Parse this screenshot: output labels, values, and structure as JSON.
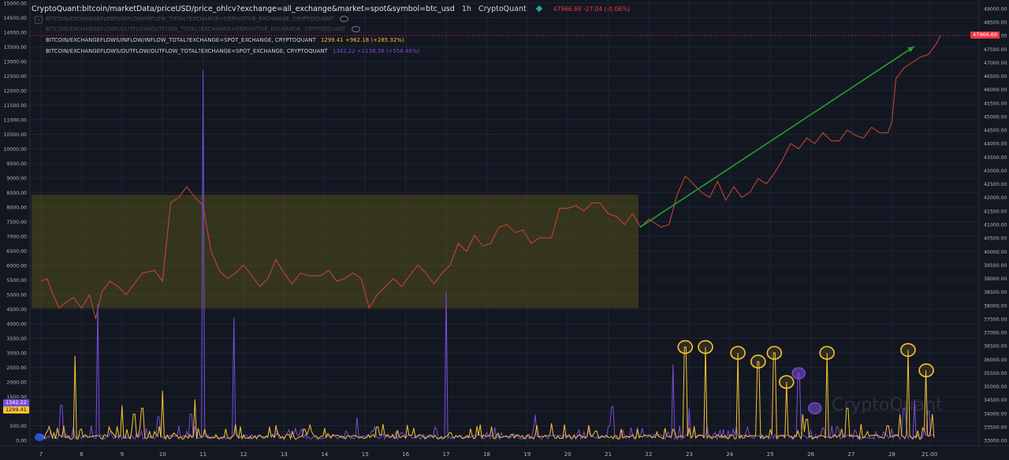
{
  "header": {
    "symbol": "CryptoQuant:bitcoin/marketData/priceUSD/price_ohlcv?exchange=all_exchange&market=spot&symbol=btc_usd",
    "interval": "1h",
    "source": "CryptoQuant",
    "ohlc": "47966.69  -27.04 (-0.06%)"
  },
  "legend": [
    {
      "label": "BITCOIN/EXCHANGEFLOWS/INFLOW/INFLOW_TOTAL?EXCHANGE=DERIVATIVE_EXCHANGE, CRYPTOQUANT",
      "value": "",
      "color": "#4a4d58",
      "hidden": true
    },
    {
      "label": "BITCOIN/EXCHANGEFLOWS/OUTFLOW/OUTFLOW_TOTAL?EXCHANGE=DERIVATIVE_EXCHANGE, CRYPTOQUANT",
      "value": "",
      "color": "#4a4d58",
      "hidden": true
    },
    {
      "label": "BITCOIN/EXCHANGEFLOWS/INFLOW/INFLOW_TOTAL?EXCHANGE=SPOT_EXCHANGE, CRYPTOQUANT",
      "value": "1299.41  +962.18 (+285.32%)",
      "color": "#f7c330",
      "hidden": false
    },
    {
      "label": "BITCOIN/EXCHANGEFLOWS/OUTFLOW/OUTFLOW_TOTAL?EXCHANGE=SPOT_EXCHANGE, CRYPTOQUANT",
      "value": "1342.22  +1138.38 (+558.46%)",
      "color": "#7b4dd8",
      "hidden": false
    }
  ],
  "price_tag": "47966.69",
  "left_tags": {
    "outflow": "1342.22",
    "inflow": "1299.41"
  },
  "watermark": "CryptoQuant",
  "colors": {
    "background": "#131722",
    "price": "#c0452e",
    "inflow": "#f7c330",
    "outflow": "#7b4dd8",
    "trend_arrow": "#22a02a",
    "range_box": "#6e6414"
  },
  "chart_data": {
    "type": "line",
    "x_tick_labels": [
      "7",
      "8",
      "9",
      "10",
      "11",
      "12",
      "13",
      "14",
      "15",
      "16",
      "17",
      "18",
      "19",
      "20",
      "21",
      "22",
      "23",
      "24",
      "25",
      "26",
      "27",
      "28",
      "21:00"
    ],
    "left_axis": {
      "ylim": [
        0,
        15000
      ],
      "ticks": [
        0,
        500,
        1000,
        1500,
        2000,
        2500,
        3000,
        3500,
        4000,
        4500,
        5000,
        5500,
        6000,
        6500,
        7000,
        7500,
        8000,
        8500,
        9000,
        9500,
        10000,
        10500,
        11000,
        11500,
        12000,
        12500,
        13000,
        13500,
        14000,
        14500,
        15000
      ]
    },
    "right_axis": {
      "ylim": [
        32800,
        49200
      ],
      "ticks": [
        33000,
        33500,
        34000,
        34500,
        35000,
        35500,
        36000,
        36500,
        37000,
        37500,
        38000,
        38500,
        39000,
        39500,
        40000,
        40500,
        41000,
        41500,
        42000,
        42500,
        43000,
        43500,
        44000,
        44500,
        45000,
        45500,
        46000,
        46500,
        47000,
        47500,
        48000,
        48500,
        49000
      ]
    },
    "series": [
      {
        "name": "price_usd",
        "axis": "right",
        "points": [
          [
            0,
            38900
          ],
          [
            0.15,
            39000
          ],
          [
            0.3,
            38400
          ],
          [
            0.45,
            37900
          ],
          [
            0.6,
            38100
          ],
          [
            0.8,
            38300
          ],
          [
            1.0,
            37900
          ],
          [
            1.2,
            38400
          ],
          [
            1.35,
            37500
          ],
          [
            1.5,
            38500
          ],
          [
            1.7,
            38900
          ],
          [
            1.9,
            38700
          ],
          [
            2.1,
            38400
          ],
          [
            2.3,
            38800
          ],
          [
            2.5,
            39200
          ],
          [
            2.8,
            39300
          ],
          [
            3.0,
            38900
          ],
          [
            3.2,
            41800
          ],
          [
            3.4,
            42000
          ],
          [
            3.6,
            42400
          ],
          [
            3.8,
            42000
          ],
          [
            4.0,
            41700
          ],
          [
            4.2,
            40000
          ],
          [
            4.4,
            39300
          ],
          [
            4.6,
            39000
          ],
          [
            4.8,
            39200
          ],
          [
            5.0,
            39500
          ],
          [
            5.2,
            39100
          ],
          [
            5.4,
            38700
          ],
          [
            5.6,
            39000
          ],
          [
            5.8,
            39700
          ],
          [
            6.0,
            39200
          ],
          [
            6.2,
            38800
          ],
          [
            6.4,
            39200
          ],
          [
            6.6,
            39100
          ],
          [
            6.9,
            39100
          ],
          [
            7.1,
            39300
          ],
          [
            7.3,
            38900
          ],
          [
            7.5,
            39000
          ],
          [
            7.7,
            39200
          ],
          [
            7.9,
            39000
          ],
          [
            8.1,
            37900
          ],
          [
            8.3,
            38400
          ],
          [
            8.5,
            38700
          ],
          [
            8.7,
            39000
          ],
          [
            8.9,
            38700
          ],
          [
            9.1,
            39100
          ],
          [
            9.3,
            39500
          ],
          [
            9.5,
            39200
          ],
          [
            9.7,
            38800
          ],
          [
            9.9,
            39200
          ],
          [
            10.1,
            39500
          ],
          [
            10.3,
            40300
          ],
          [
            10.5,
            40000
          ],
          [
            10.7,
            40600
          ],
          [
            10.9,
            40200
          ],
          [
            11.1,
            40300
          ],
          [
            11.3,
            40900
          ],
          [
            11.5,
            41000
          ],
          [
            11.7,
            40700
          ],
          [
            11.9,
            40800
          ],
          [
            12.1,
            40300
          ],
          [
            12.3,
            40500
          ],
          [
            12.6,
            40500
          ],
          [
            12.8,
            41600
          ],
          [
            13.0,
            41600
          ],
          [
            13.2,
            41700
          ],
          [
            13.4,
            41500
          ],
          [
            13.6,
            41800
          ],
          [
            13.8,
            41800
          ],
          [
            14.0,
            41400
          ],
          [
            14.2,
            41300
          ],
          [
            14.4,
            41000
          ],
          [
            14.6,
            41400
          ],
          [
            14.8,
            40900
          ],
          [
            15.0,
            41200
          ],
          [
            15.3,
            40900
          ],
          [
            15.5,
            41000
          ],
          [
            15.7,
            42100
          ],
          [
            15.9,
            42800
          ],
          [
            16.1,
            42500
          ],
          [
            16.3,
            42200
          ],
          [
            16.5,
            42000
          ],
          [
            16.7,
            42600
          ],
          [
            16.9,
            41900
          ],
          [
            17.1,
            42400
          ],
          [
            17.3,
            42000
          ],
          [
            17.5,
            42200
          ],
          [
            17.7,
            42700
          ],
          [
            17.9,
            42500
          ],
          [
            18.1,
            42900
          ],
          [
            18.3,
            43400
          ],
          [
            18.5,
            44000
          ],
          [
            18.7,
            43800
          ],
          [
            18.9,
            44200
          ],
          [
            19.1,
            44000
          ],
          [
            19.3,
            44400
          ],
          [
            19.5,
            44100
          ],
          [
            19.7,
            44100
          ],
          [
            19.9,
            44500
          ],
          [
            20.1,
            44300
          ],
          [
            20.3,
            44200
          ],
          [
            20.5,
            44600
          ],
          [
            20.7,
            44400
          ],
          [
            20.9,
            44400
          ],
          [
            21.0,
            44800
          ],
          [
            21.1,
            46400
          ],
          [
            21.3,
            46800
          ],
          [
            21.5,
            47000
          ],
          [
            21.7,
            47200
          ],
          [
            21.9,
            47300
          ],
          [
            22.1,
            47700
          ],
          [
            22.2,
            48000
          ]
        ]
      },
      {
        "name": "inflow_spot",
        "axis": "left",
        "spikes": [
          [
            0.15,
            300
          ],
          [
            0.55,
            500
          ],
          [
            0.85,
            2900
          ],
          [
            1.35,
            150
          ],
          [
            2.0,
            1200
          ],
          [
            2.3,
            900
          ],
          [
            2.5,
            1100
          ],
          [
            2.8,
            300
          ],
          [
            3.0,
            1700
          ],
          [
            3.8,
            1400
          ],
          [
            4.05,
            380
          ],
          [
            4.5,
            100
          ],
          [
            5.6,
            100
          ],
          [
            5.8,
            520
          ],
          [
            6.2,
            320
          ],
          [
            6.5,
            380
          ],
          [
            7.4,
            100
          ],
          [
            7.9,
            120
          ],
          [
            8.3,
            460
          ],
          [
            8.8,
            350
          ],
          [
            9.2,
            420
          ],
          [
            10.1,
            260
          ],
          [
            10.6,
            400
          ],
          [
            11.4,
            120
          ],
          [
            11.8,
            160
          ],
          [
            12.2,
            200
          ],
          [
            12.6,
            580
          ],
          [
            13.3,
            180
          ],
          [
            13.7,
            320
          ],
          [
            14.2,
            160
          ],
          [
            14.6,
            200
          ],
          [
            15.0,
            180
          ],
          [
            15.4,
            420
          ],
          [
            15.6,
            380
          ],
          [
            15.9,
            3200
          ],
          [
            16.4,
            3200
          ],
          [
            17.2,
            3000
          ],
          [
            17.7,
            2700
          ],
          [
            18.1,
            3000
          ],
          [
            18.4,
            2000
          ],
          [
            18.8,
            900
          ],
          [
            18.9,
            720
          ],
          [
            19.4,
            3000
          ],
          [
            19.9,
            1100
          ],
          [
            20.4,
            300
          ],
          [
            20.9,
            500
          ],
          [
            21.2,
            900
          ],
          [
            21.4,
            3100
          ],
          [
            21.85,
            2400
          ],
          [
            22.0,
            900
          ]
        ]
      },
      {
        "name": "outflow_spot",
        "axis": "left",
        "spikes": [
          [
            0.5,
            1200
          ],
          [
            1.25,
            500
          ],
          [
            1.4,
            4700
          ],
          [
            2.9,
            800
          ],
          [
            3.7,
            900
          ],
          [
            4.0,
            12700
          ],
          [
            4.75,
            4200
          ],
          [
            5.4,
            180
          ],
          [
            6.6,
            120
          ],
          [
            7.8,
            780
          ],
          [
            8.9,
            250
          ],
          [
            10.0,
            5100
          ],
          [
            11.2,
            450
          ],
          [
            12.2,
            880
          ],
          [
            13.0,
            160
          ],
          [
            14.1,
            1160
          ],
          [
            15.0,
            120
          ],
          [
            15.6,
            2600
          ],
          [
            16.0,
            1100
          ],
          [
            16.6,
            200
          ],
          [
            17.4,
            280
          ],
          [
            18.7,
            2300
          ],
          [
            19.3,
            420
          ],
          [
            20.6,
            300
          ],
          [
            21.0,
            400
          ],
          [
            21.3,
            1100
          ],
          [
            21.55,
            1400
          ],
          [
            21.9,
            1000
          ]
        ]
      }
    ]
  }
}
